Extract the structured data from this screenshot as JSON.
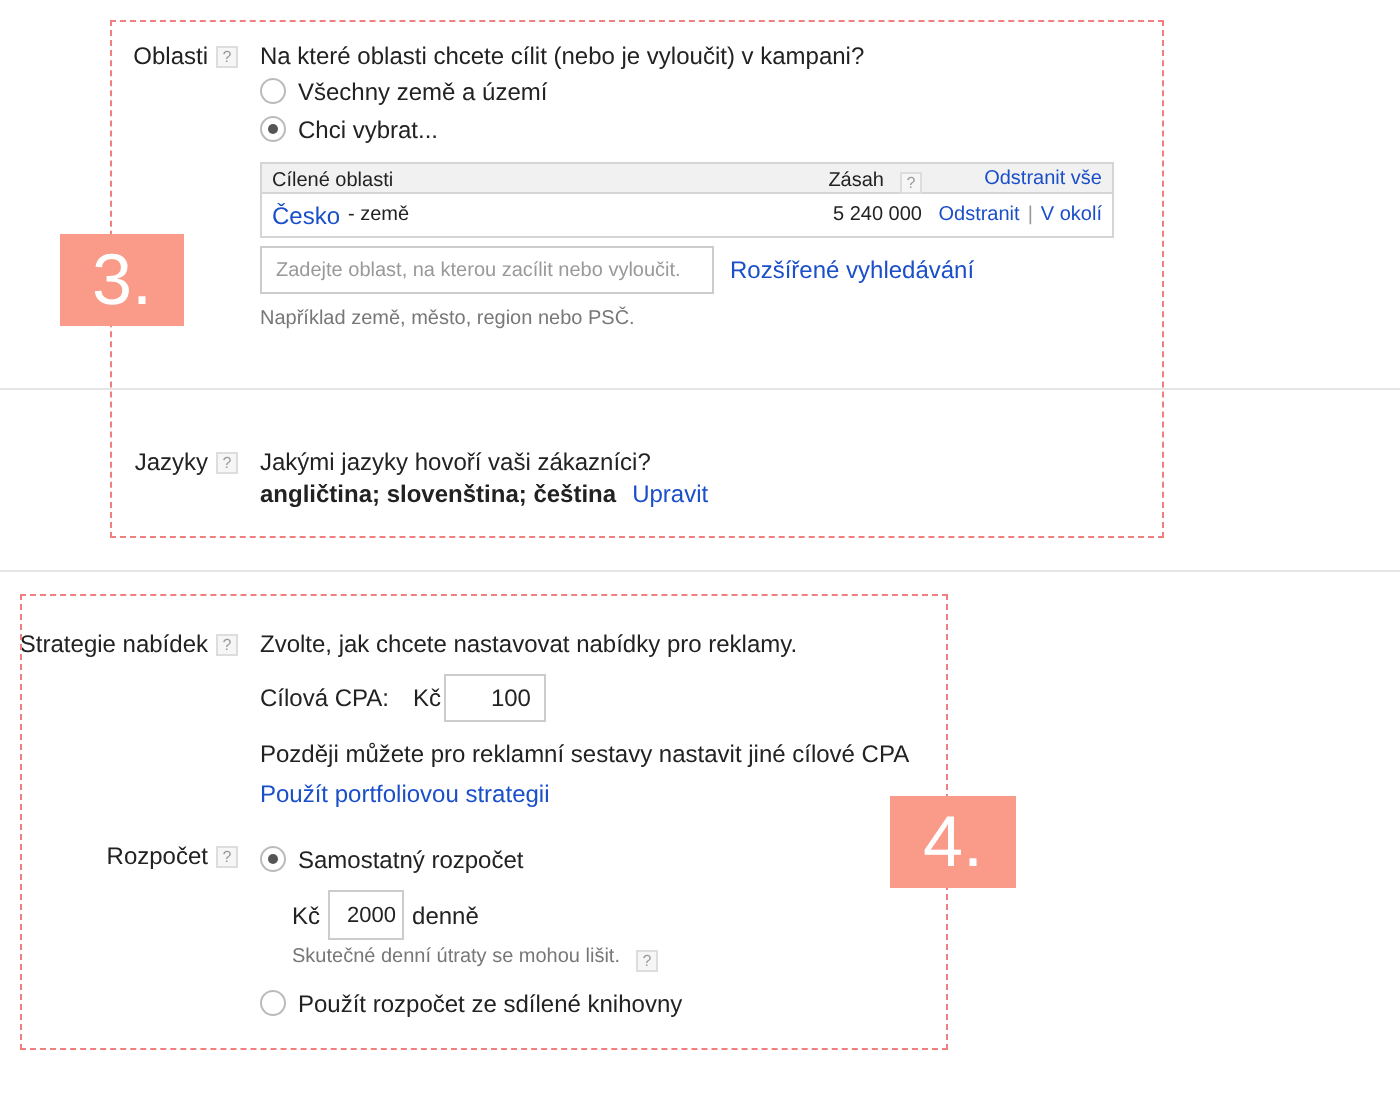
{
  "locations": {
    "label": "Oblasti",
    "help": "?",
    "question": "Na které oblasti chcete cílit (nebo je vyloučit) v kampani?",
    "options": [
      {
        "label": "Všechny země a území",
        "selected": false
      },
      {
        "label": "Chci vybrat...",
        "selected": true
      }
    ],
    "table": {
      "columns": [
        {
          "label": "Cílené oblasti"
        },
        {
          "label": "Zásah",
          "help": "?"
        }
      ],
      "remove_all": "Odstranit vše",
      "rows": [
        {
          "name": "Česko",
          "type": "- země",
          "reach": "5 240 000",
          "actions": [
            "Odstranit",
            "V okolí"
          ],
          "separator": "|"
        }
      ]
    },
    "search": {
      "placeholder": "Zadejte oblast, na kterou zacílit nebo vyloučit."
    },
    "advanced_link": "Rozšířené vyhledávání",
    "hint": "Například země, město, region nebo PSČ."
  },
  "languages": {
    "label": "Jazyky",
    "help": "?",
    "question": "Jakými jazyky hovoří vaši zákazníci?",
    "value": "angličtina; slovenština; čeština",
    "edit_link": "Upravit"
  },
  "bidding": {
    "label": "Strategie nabídek",
    "help": "?",
    "question": "Zvolte, jak chcete nastavovat nabídky pro reklamy.",
    "cpa": {
      "label": "Cílová CPA:",
      "currency": "Kč",
      "value": "100"
    },
    "note": "Později můžete pro reklamní sestavy nastavit jiné cílové CPA",
    "link": "Použít portfoliovou strategii"
  },
  "budget": {
    "label": "Rozpočet",
    "help": "?",
    "options": [
      {
        "kind": "individual",
        "label": "Samostatný rozpočet",
        "selected": true,
        "currency": "Kč",
        "value": "2000",
        "unit": "denně",
        "hint": "Skutečné denní útraty se mohou lišit.",
        "help": "?"
      },
      {
        "kind": "shared",
        "label": "Použít rozpočet ze sdílené knihovny",
        "selected": false
      }
    ]
  },
  "annotations": [
    {
      "label": "3."
    },
    {
      "label": "4."
    }
  ]
}
